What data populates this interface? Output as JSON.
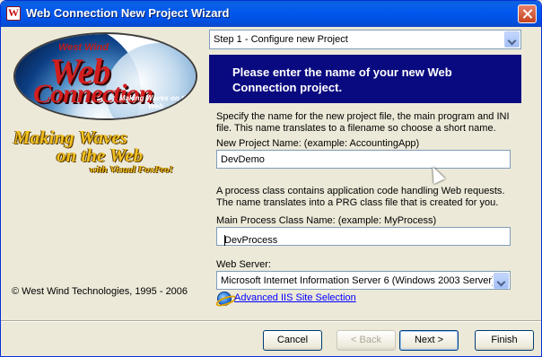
{
  "window": {
    "title": "Web Connection New Project Wizard"
  },
  "logo": {
    "top_text": "West Wind",
    "word1": "Web",
    "word2": "Connection",
    "tagline": "Making Waves on the Web"
  },
  "slogan": {
    "line1": "Making Waves",
    "line2": "on the Web",
    "line3": "with Visual FoxPro!"
  },
  "copyright": "© West Wind Technologies, 1995 - 2006",
  "step_selector": {
    "value": "Step 1 - Configure new Project"
  },
  "banner": {
    "text": "Please enter the name of your new Web Connection project."
  },
  "project_section": {
    "description": "Specify the name for the new project file, the main program and INI file. This name translates to a filename so choose a short name.",
    "label": "New Project Name:   (example: AccountingApp)",
    "value": "DevDemo"
  },
  "process_section": {
    "description": "A process class contains application code handling Web requests. The name translates into a PRG class file that is created for you.",
    "label": "Main Process Class Name:  (example: MyProcess)",
    "value": "DevProcess"
  },
  "server_section": {
    "label": "Web Server:",
    "value": "Microsoft Internet Information Server 6 (Windows 2003 Server)"
  },
  "advanced_link": "Advanced  IIS Site Selection",
  "buttons": {
    "cancel": "Cancel",
    "back": "< Back",
    "next": "Next >",
    "finish": "Finish"
  },
  "colors": {
    "banner_bg": "#0a0a80",
    "titlebar": "#0058ee",
    "link": "#0000ff"
  }
}
